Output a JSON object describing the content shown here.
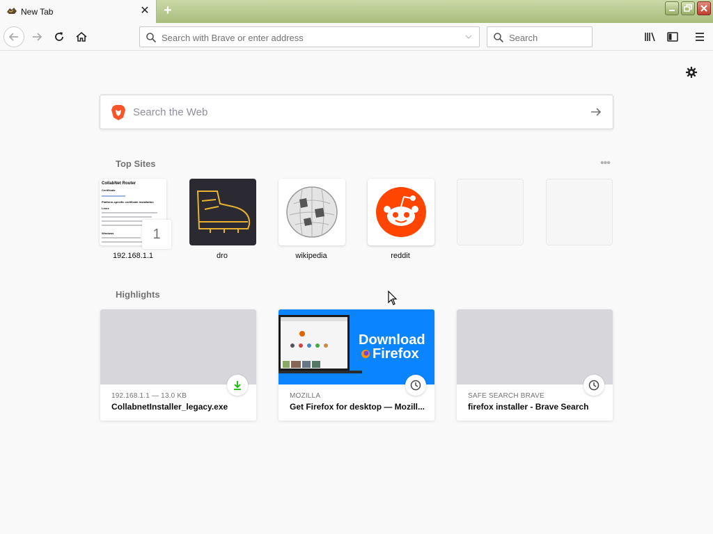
{
  "browser": {
    "tab_title": "New Tab",
    "new_tab_symbol": "+",
    "close_symbol": "✕",
    "urlbar_placeholder": "Search with Brave or enter address",
    "searchbar_placeholder": "Search"
  },
  "icons": {
    "back": "back-arrow-icon",
    "forward": "forward-arrow-icon",
    "reload": "reload-icon",
    "home": "home-icon",
    "library": "library-icon",
    "sidebar": "sidebar-icon",
    "menu": "hamburger-menu-icon",
    "settings": "gear-icon",
    "brave": "brave-lion-icon"
  },
  "newtab": {
    "search_placeholder": "Search the Web",
    "top_sites_title": "Top Sites",
    "more_symbol": "•••",
    "highlights_title": "Highlights",
    "top_sites": [
      {
        "label": "192.168.1.1",
        "pin_number": "1",
        "thumb_heading": "CollabNet Router",
        "thumb_sub": "Certificate",
        "thumb_sub2": "Platform-specific certificate installation",
        "thumb_sub3": "Linux",
        "thumb_sub4": "Windows"
      },
      {
        "label": "dro"
      },
      {
        "label": "wikipedia"
      },
      {
        "label": "reddit"
      }
    ],
    "highlights": [
      {
        "source": "192.168.1.1 — 13.0 KB",
        "title": "CollabnetInstaller_legacy.exe",
        "badge": "download-icon"
      },
      {
        "source": "MOZILLA",
        "title": "Get Firefox for desktop — Mozill...",
        "badge": "clock-icon",
        "image_line1": "Download",
        "image_line2": "Firefox"
      },
      {
        "source": "SAFE SEARCH BRAVE",
        "title": "firefox installer - Brave Search",
        "badge": "clock-icon"
      }
    ]
  },
  "colors": {
    "accent": "#0a84ff",
    "reddit": "#ff4500",
    "brave": "#fb542b",
    "titlebar": "#b5c88b"
  }
}
